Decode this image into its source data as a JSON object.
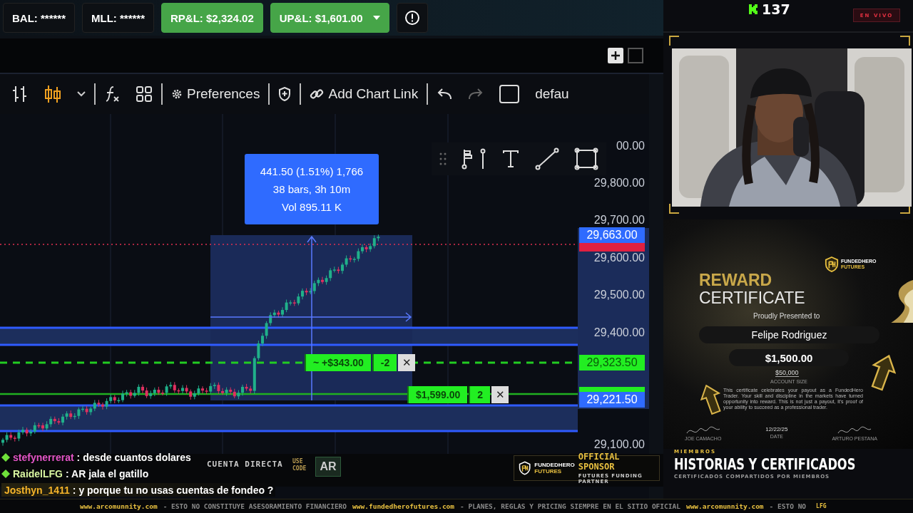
{
  "account_bar": {
    "items": [
      {
        "label": "BAL: ******",
        "highlight": false,
        "dropdown": false
      },
      {
        "label": "MLL: ******",
        "highlight": false,
        "dropdown": false
      },
      {
        "label": "RP&L: $2,324.02",
        "highlight": true,
        "dropdown": false
      },
      {
        "label": "UP&L: $1,601.00",
        "highlight": true,
        "dropdown": true
      }
    ]
  },
  "toolbar": {
    "preferences": "Preferences",
    "chart_link": "Add Chart Link",
    "layout": "defau"
  },
  "chart": {
    "price_labels": [
      "00.00",
      "29,800.00",
      "29,700.00",
      "29,600.00",
      "29,500.00",
      "29,400.00",
      "29,100.00"
    ],
    "measure": {
      "lines": [
        "441.50 (1.51%) 1,766",
        "38 bars, 3h 10m",
        "Vol 895.11 K"
      ]
    },
    "price_badges": [
      {
        "text": "29,663.00",
        "color": "#2f6bff"
      },
      {
        "text": "29,323.50",
        "color": "#22ee22"
      },
      {
        "text": "29,221.50",
        "color": "#2f6bff"
      }
    ],
    "orders": [
      {
        "pnl": "~ +$343.00",
        "qty": "-2",
        "close": "✕"
      },
      {
        "pnl": "$1,599.00",
        "qty": "2",
        "close": "✕"
      }
    ]
  },
  "promo": {
    "title": "CUENTA DIRECTA",
    "code_label": "USE CODE",
    "code": "AR"
  },
  "sponsor": {
    "brand_top": "FUNDEDHERO",
    "brand_bottom": "FUTURES",
    "title": "OFFICIAL SPONSOR",
    "subtitle": "FUTURES FUNDING PARTNER"
  },
  "chat": [
    {
      "user": "stefynerrerat",
      "text": ": desde cuantos dolares",
      "color": "#e455c8",
      "badge": true
    },
    {
      "user": "RaidelLFG",
      "text": ": AR jala el gatillo",
      "color": "#d8f5a0",
      "badge": true
    },
    {
      "user": "Josthyn_1411",
      "text": ": y porque tu no usas cuentas de fondeo ?",
      "color": "#f5b42a",
      "badge": false
    }
  ],
  "ticker": [
    {
      "kind": "link",
      "text": "www.arcomunnity.com"
    },
    {
      "kind": "note",
      "text": "- ESTO NO CONSTITUYE ASESORAMIENTO FINANCIERO"
    },
    {
      "kind": "link",
      "text": "www.fundedherofutures.com"
    },
    {
      "kind": "note",
      "text": "- PLANES, REGLAS Y PRICING SIEMPRE EN EL SITIO OFICIAL"
    },
    {
      "kind": "link",
      "text": "www.arcomunnity.com"
    },
    {
      "kind": "note",
      "text": "- ESTO NO"
    },
    {
      "kind": "tag",
      "text": "LFG"
    }
  ],
  "stream": {
    "viewer_count": "137",
    "live_badge": "EN VIVO"
  },
  "certificate": {
    "brand_top": "FUNDEDHERO",
    "brand_bottom": "FUTURES",
    "title_top": "REWARD",
    "title_bottom": "CERTIFICATE",
    "presented": "Proudly Presented to",
    "recipient": "Felipe Rodriguez",
    "amount": "$1,500.00",
    "account_size": "$50,000",
    "account_size_label": "ACCOUNT SIZE",
    "body": "This certificate celebrates your payout as a FundedHero Trader. Your skill and discipline in the markets have turned opportunity into reward. This is not just a payout, it's proof of your ability to succeed as a professional trader.",
    "signers": [
      {
        "name": "JOE CAMACHO"
      },
      {
        "name": "DATE",
        "line": "12/22/25"
      },
      {
        "name": "ARTURO PESTANA"
      }
    ]
  },
  "section": {
    "eyebrow": "MIEMBROS",
    "title": "HISTORIAS Y CERTIFICADOS",
    "subtitle": "CERTIFICADOS COMPARTIDOS POR MIEMBROS"
  }
}
